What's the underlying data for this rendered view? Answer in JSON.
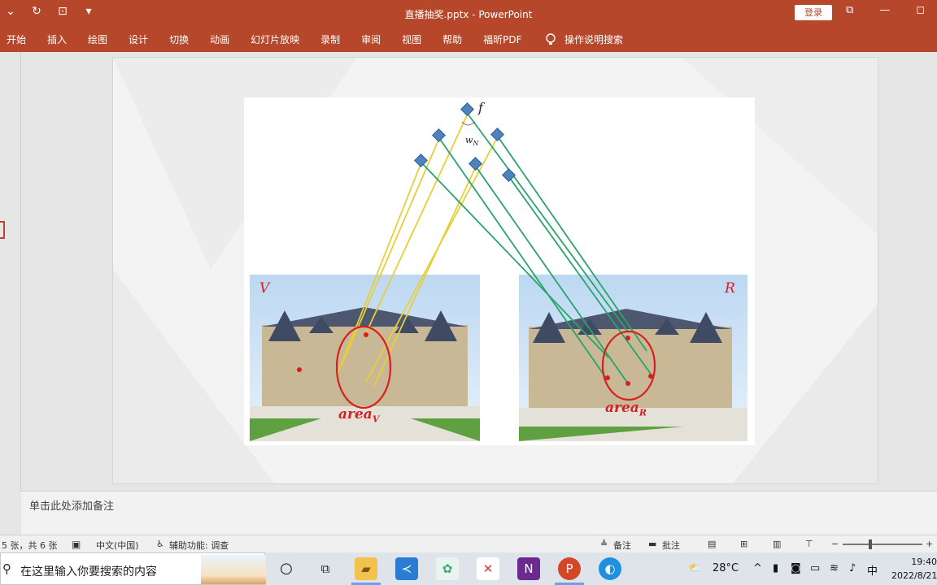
{
  "window": {
    "title": "直播抽奖.pptx  -  PowerPoint",
    "login_label": "登录",
    "controls": [
      "⧉",
      "—",
      "◻"
    ]
  },
  "qat": [
    "⌄",
    "↻",
    "⊡",
    "▾"
  ],
  "ribbon": {
    "tabs": [
      "开始",
      "插入",
      "绘图",
      "设计",
      "切换",
      "动画",
      "幻灯片放映",
      "录制",
      "审阅",
      "视图",
      "帮助",
      "福昕PDF"
    ],
    "tell_me": "操作说明搜索"
  },
  "slide": {
    "diagram": {
      "top_label": "f",
      "weight_label": "w",
      "weight_sub": "N",
      "left_image_label": "V",
      "right_image_label": "R",
      "left_area_label": "area",
      "left_area_sub": "V",
      "right_area_label": "area",
      "right_area_sub": "R"
    }
  },
  "notes": {
    "placeholder": "单击此处添加备注"
  },
  "status": {
    "slide_count": "5 张，共 6 张",
    "language": "中文(中国)",
    "accessibility": "辅助功能: 调查",
    "notes_btn": "备注",
    "comments_btn": "批注",
    "zoom_minus": "−",
    "zoom_plus": "+"
  },
  "taskbar": {
    "search_placeholder": "在这里输入你要搜索的内容",
    "weather": "28°C",
    "ime": "中",
    "time": "19:40",
    "date": "2022/8/21"
  },
  "colors": {
    "accent": "#b7472a",
    "yellow_arrow": "#e6cf3a",
    "green_arrow": "#2aa36b",
    "node": "#4f81bd",
    "red_mark": "#d81e1e"
  }
}
